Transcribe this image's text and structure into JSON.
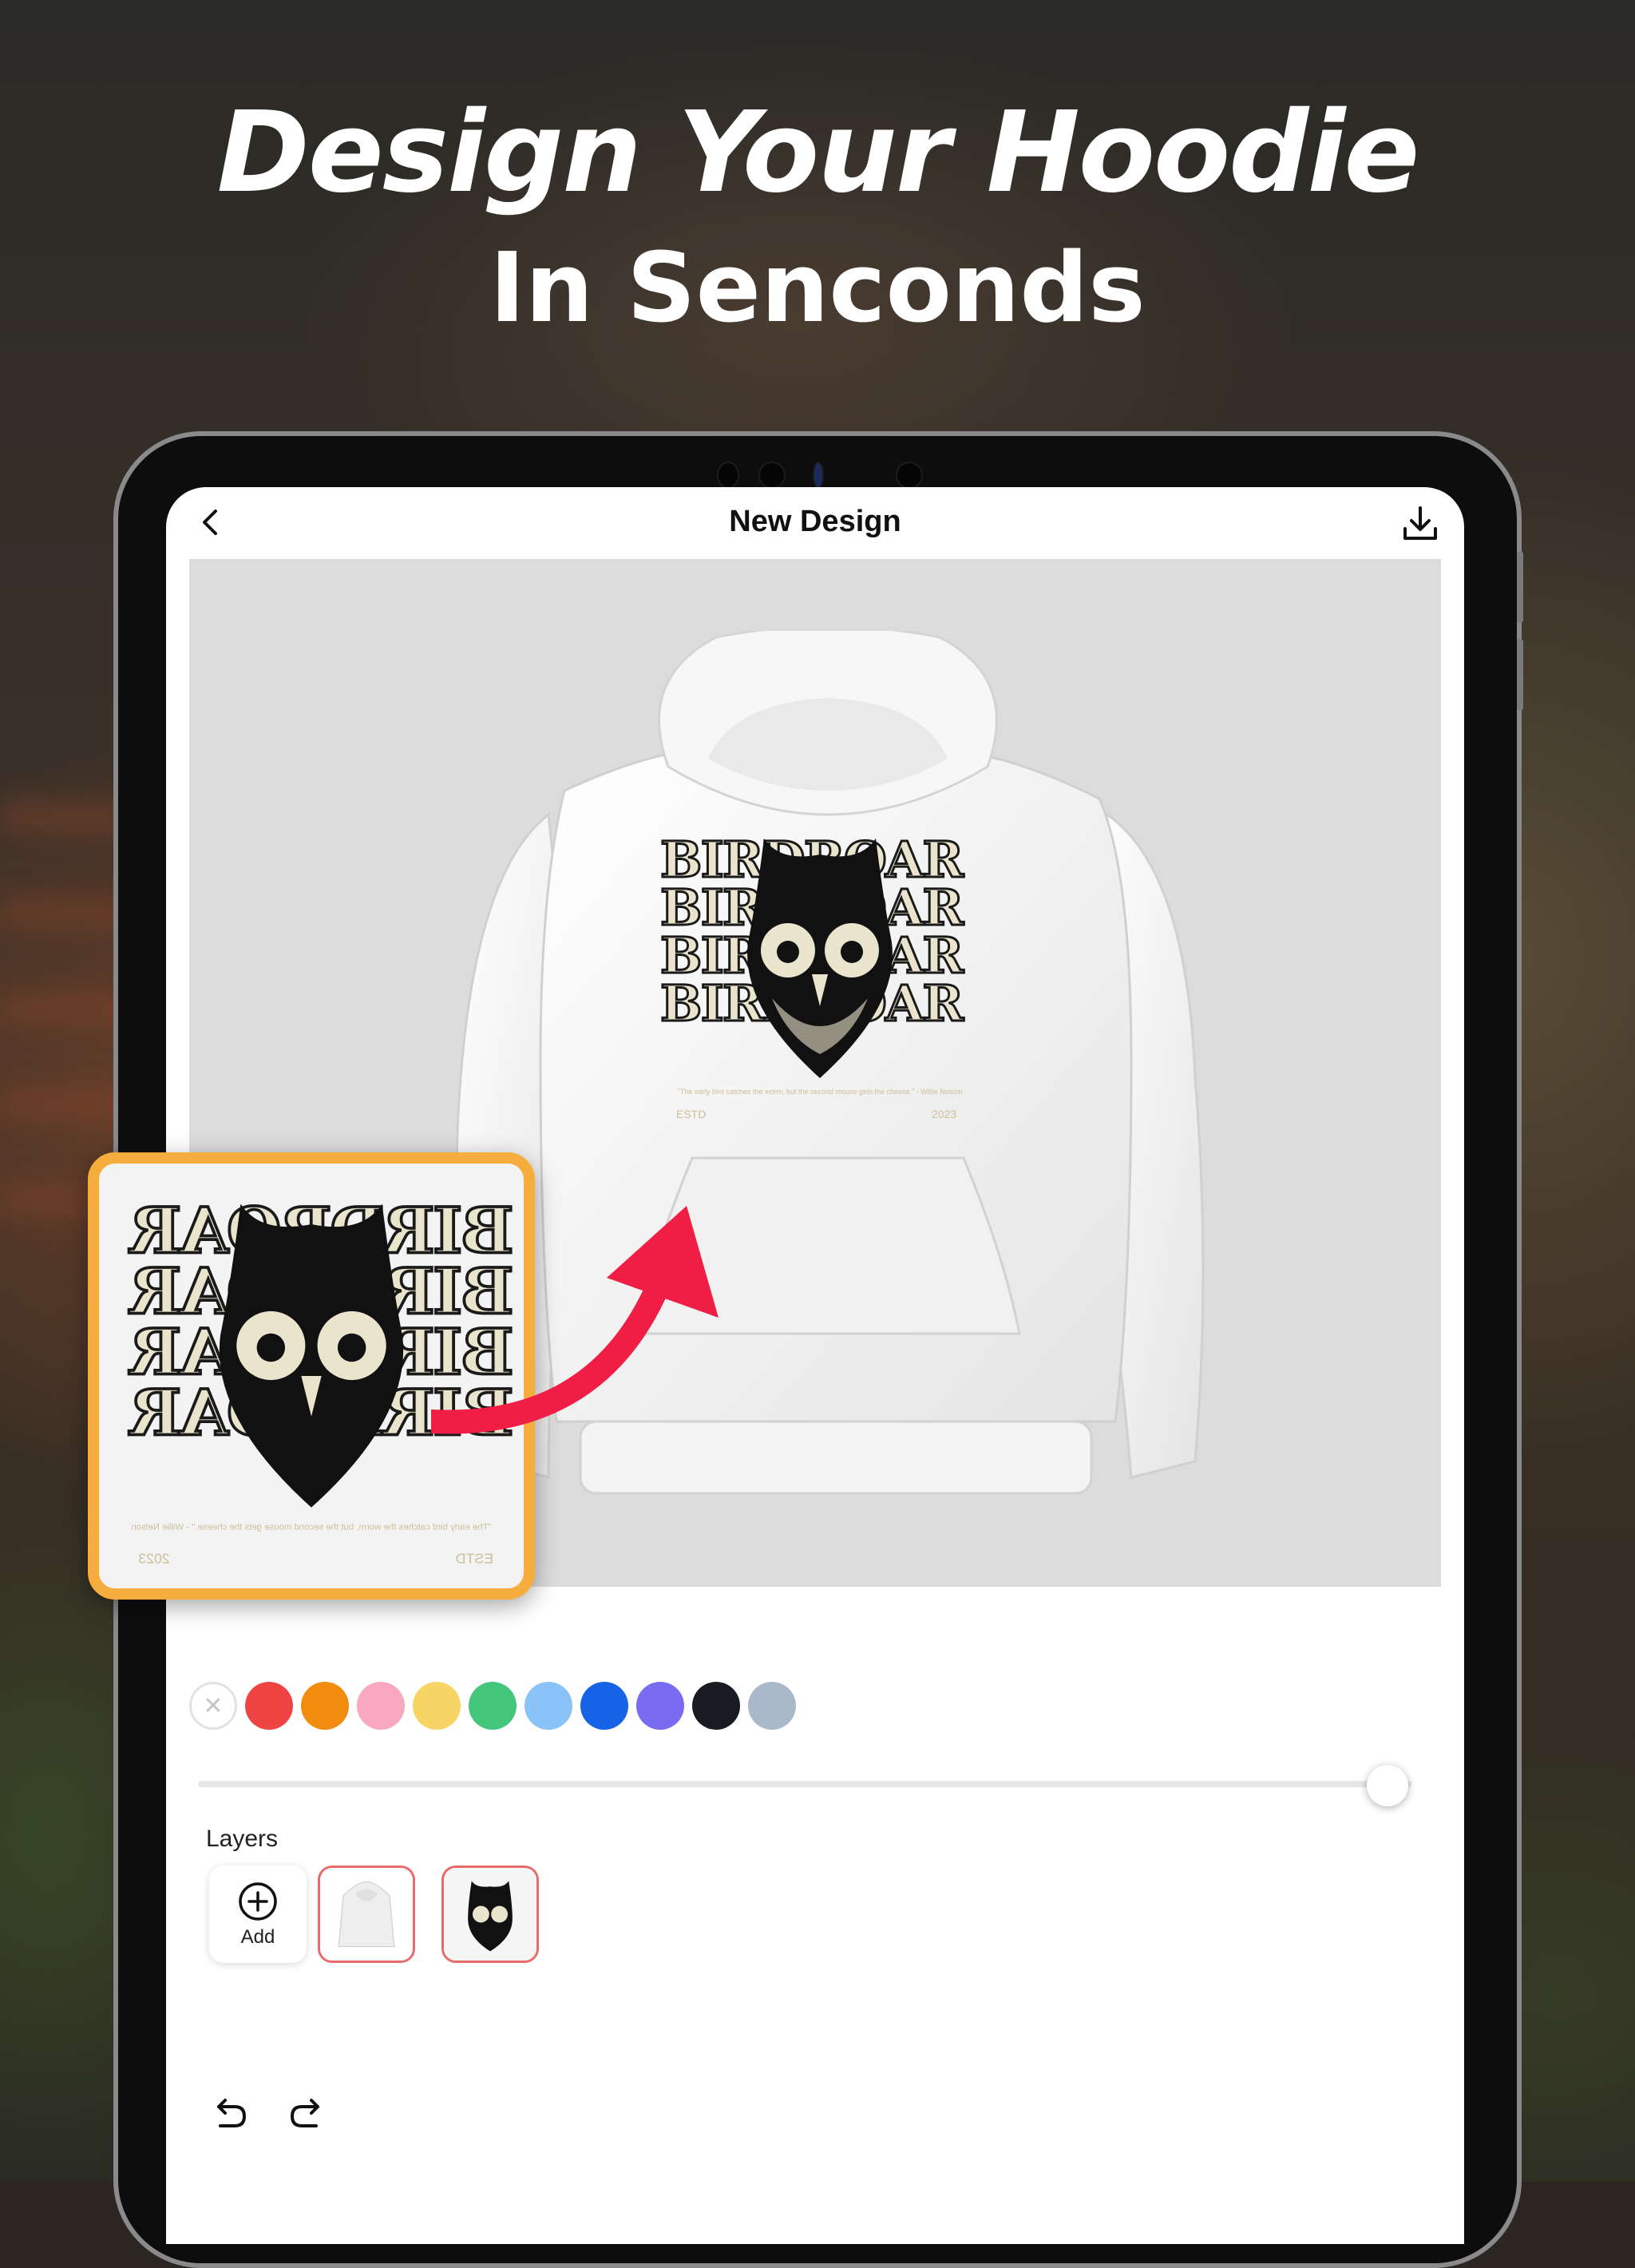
{
  "hero": {
    "title": "Design Your Hoodie",
    "subtitle": "In Senconds"
  },
  "app": {
    "title": "New Design",
    "back_icon": "chevron-left-icon",
    "download_icon": "download-icon"
  },
  "canvas": {
    "background": "#dcdcdc",
    "graphic_text": "BIRDROAR",
    "quote": "\"The early bird catches the worm, but the second mouse gets the cheese.\" - Willie Nelson",
    "estd": "ESTD",
    "year": "2023"
  },
  "toolbar": {
    "undo_icon": "undo-icon",
    "redo_icon": "redo-icon"
  },
  "swatches": [
    {
      "name": "none",
      "color": "#ffffff"
    },
    {
      "name": "red",
      "color": "#ef4444"
    },
    {
      "name": "orange",
      "color": "#f28c0f"
    },
    {
      "name": "pink",
      "color": "#f8a9c0"
    },
    {
      "name": "yellow",
      "color": "#f8d464"
    },
    {
      "name": "green",
      "color": "#44c77a"
    },
    {
      "name": "light-blue",
      "color": "#89c3f8"
    },
    {
      "name": "blue",
      "color": "#1763e8"
    },
    {
      "name": "purple",
      "color": "#7a6cf0"
    },
    {
      "name": "black",
      "color": "#181c22"
    },
    {
      "name": "slate",
      "color": "#a9b9c9"
    }
  ],
  "slider": {
    "value": 0.98
  },
  "layers": {
    "label": "Layers",
    "add_label": "Add",
    "items": [
      "hoodie-layer",
      "owl-graphic-layer"
    ]
  }
}
